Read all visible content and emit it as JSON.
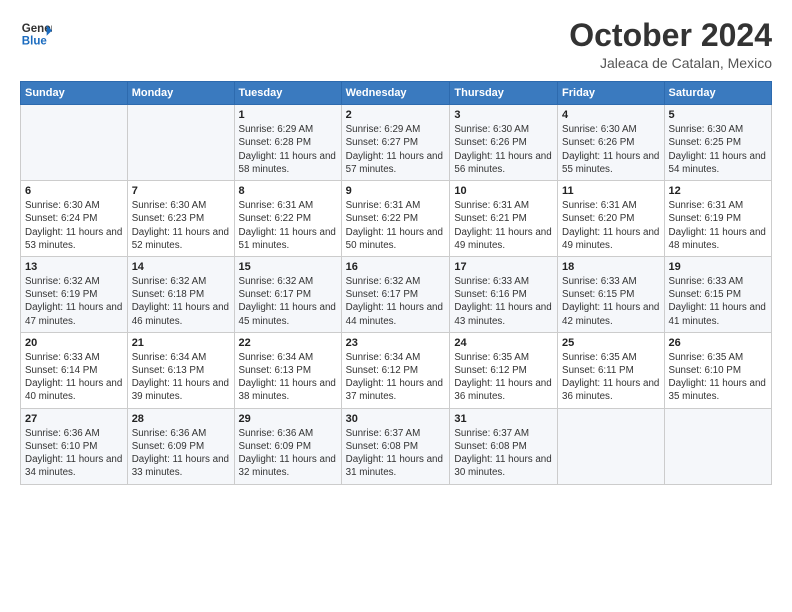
{
  "logo": {
    "line1": "General",
    "line2": "Blue"
  },
  "title": "October 2024",
  "subtitle": "Jaleaca de Catalan, Mexico",
  "weekdays": [
    "Sunday",
    "Monday",
    "Tuesday",
    "Wednesday",
    "Thursday",
    "Friday",
    "Saturday"
  ],
  "weeks": [
    [
      {
        "day": "",
        "info": ""
      },
      {
        "day": "",
        "info": ""
      },
      {
        "day": "1",
        "info": "Sunrise: 6:29 AM\nSunset: 6:28 PM\nDaylight: 11 hours and 58 minutes."
      },
      {
        "day": "2",
        "info": "Sunrise: 6:29 AM\nSunset: 6:27 PM\nDaylight: 11 hours and 57 minutes."
      },
      {
        "day": "3",
        "info": "Sunrise: 6:30 AM\nSunset: 6:26 PM\nDaylight: 11 hours and 56 minutes."
      },
      {
        "day": "4",
        "info": "Sunrise: 6:30 AM\nSunset: 6:26 PM\nDaylight: 11 hours and 55 minutes."
      },
      {
        "day": "5",
        "info": "Sunrise: 6:30 AM\nSunset: 6:25 PM\nDaylight: 11 hours and 54 minutes."
      }
    ],
    [
      {
        "day": "6",
        "info": "Sunrise: 6:30 AM\nSunset: 6:24 PM\nDaylight: 11 hours and 53 minutes."
      },
      {
        "day": "7",
        "info": "Sunrise: 6:30 AM\nSunset: 6:23 PM\nDaylight: 11 hours and 52 minutes."
      },
      {
        "day": "8",
        "info": "Sunrise: 6:31 AM\nSunset: 6:22 PM\nDaylight: 11 hours and 51 minutes."
      },
      {
        "day": "9",
        "info": "Sunrise: 6:31 AM\nSunset: 6:22 PM\nDaylight: 11 hours and 50 minutes."
      },
      {
        "day": "10",
        "info": "Sunrise: 6:31 AM\nSunset: 6:21 PM\nDaylight: 11 hours and 49 minutes."
      },
      {
        "day": "11",
        "info": "Sunrise: 6:31 AM\nSunset: 6:20 PM\nDaylight: 11 hours and 49 minutes."
      },
      {
        "day": "12",
        "info": "Sunrise: 6:31 AM\nSunset: 6:19 PM\nDaylight: 11 hours and 48 minutes."
      }
    ],
    [
      {
        "day": "13",
        "info": "Sunrise: 6:32 AM\nSunset: 6:19 PM\nDaylight: 11 hours and 47 minutes."
      },
      {
        "day": "14",
        "info": "Sunrise: 6:32 AM\nSunset: 6:18 PM\nDaylight: 11 hours and 46 minutes."
      },
      {
        "day": "15",
        "info": "Sunrise: 6:32 AM\nSunset: 6:17 PM\nDaylight: 11 hours and 45 minutes."
      },
      {
        "day": "16",
        "info": "Sunrise: 6:32 AM\nSunset: 6:17 PM\nDaylight: 11 hours and 44 minutes."
      },
      {
        "day": "17",
        "info": "Sunrise: 6:33 AM\nSunset: 6:16 PM\nDaylight: 11 hours and 43 minutes."
      },
      {
        "day": "18",
        "info": "Sunrise: 6:33 AM\nSunset: 6:15 PM\nDaylight: 11 hours and 42 minutes."
      },
      {
        "day": "19",
        "info": "Sunrise: 6:33 AM\nSunset: 6:15 PM\nDaylight: 11 hours and 41 minutes."
      }
    ],
    [
      {
        "day": "20",
        "info": "Sunrise: 6:33 AM\nSunset: 6:14 PM\nDaylight: 11 hours and 40 minutes."
      },
      {
        "day": "21",
        "info": "Sunrise: 6:34 AM\nSunset: 6:13 PM\nDaylight: 11 hours and 39 minutes."
      },
      {
        "day": "22",
        "info": "Sunrise: 6:34 AM\nSunset: 6:13 PM\nDaylight: 11 hours and 38 minutes."
      },
      {
        "day": "23",
        "info": "Sunrise: 6:34 AM\nSunset: 6:12 PM\nDaylight: 11 hours and 37 minutes."
      },
      {
        "day": "24",
        "info": "Sunrise: 6:35 AM\nSunset: 6:12 PM\nDaylight: 11 hours and 36 minutes."
      },
      {
        "day": "25",
        "info": "Sunrise: 6:35 AM\nSunset: 6:11 PM\nDaylight: 11 hours and 36 minutes."
      },
      {
        "day": "26",
        "info": "Sunrise: 6:35 AM\nSunset: 6:10 PM\nDaylight: 11 hours and 35 minutes."
      }
    ],
    [
      {
        "day": "27",
        "info": "Sunrise: 6:36 AM\nSunset: 6:10 PM\nDaylight: 11 hours and 34 minutes."
      },
      {
        "day": "28",
        "info": "Sunrise: 6:36 AM\nSunset: 6:09 PM\nDaylight: 11 hours and 33 minutes."
      },
      {
        "day": "29",
        "info": "Sunrise: 6:36 AM\nSunset: 6:09 PM\nDaylight: 11 hours and 32 minutes."
      },
      {
        "day": "30",
        "info": "Sunrise: 6:37 AM\nSunset: 6:08 PM\nDaylight: 11 hours and 31 minutes."
      },
      {
        "day": "31",
        "info": "Sunrise: 6:37 AM\nSunset: 6:08 PM\nDaylight: 11 hours and 30 minutes."
      },
      {
        "day": "",
        "info": ""
      },
      {
        "day": "",
        "info": ""
      }
    ]
  ]
}
